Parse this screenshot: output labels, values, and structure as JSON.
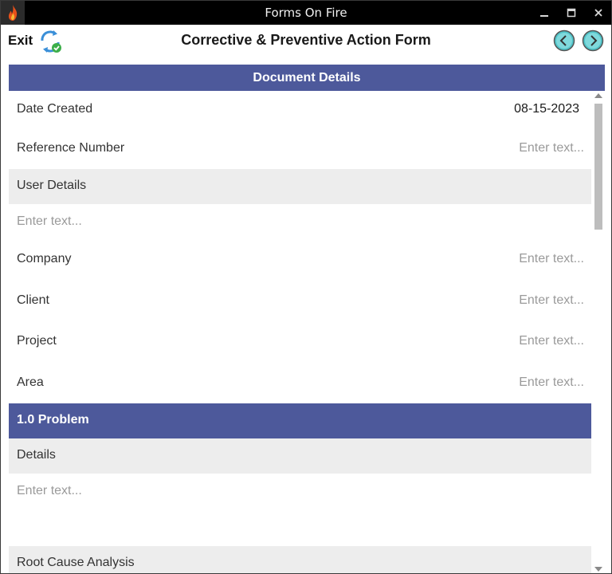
{
  "window": {
    "title": "Forms On Fire",
    "controls": {
      "minimize": "minimize-icon",
      "maximize": "maximize-icon",
      "close": "close-icon"
    }
  },
  "header": {
    "exit_label": "Exit",
    "form_title": "Corrective & Preventive Action Form",
    "sync_icon": "sync-check-icon",
    "prev_icon": "chevron-left-circle-icon",
    "next_icon": "chevron-right-circle-icon"
  },
  "colors": {
    "section_header": "#4d599b",
    "band": "#ededed",
    "accent_nav": "#4fc3c8",
    "sync_blue": "#3a8fd8",
    "sync_green": "#3cae4a"
  },
  "document_details": {
    "header": "Document Details",
    "date_created": {
      "label": "Date Created",
      "value": "08-15-2023"
    },
    "reference_number": {
      "label": "Reference Number",
      "placeholder": "Enter text..."
    },
    "user_details": {
      "label": "User Details",
      "placeholder": "Enter text..."
    },
    "company": {
      "label": "Company",
      "placeholder": "Enter text..."
    },
    "client": {
      "label": "Client",
      "placeholder": "Enter text..."
    },
    "project": {
      "label": "Project",
      "placeholder": "Enter text..."
    },
    "area": {
      "label": "Area",
      "placeholder": "Enter text..."
    }
  },
  "problem": {
    "header": "1.0 Problem",
    "details": {
      "label": "Details",
      "placeholder": "Enter text..."
    },
    "root_cause": {
      "label": "Root Cause Analysis"
    }
  }
}
